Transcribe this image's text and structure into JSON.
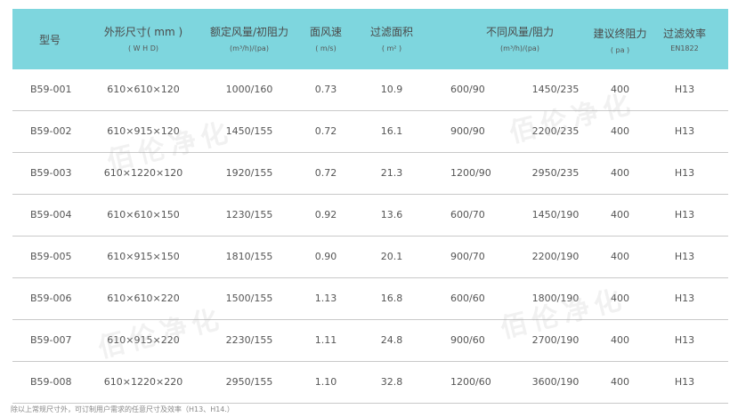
{
  "header": {
    "model": "型号",
    "size": "外形尺寸( mm )",
    "size_sub": "( W H D)",
    "airflow": "额定风量/初阻力",
    "airflow_sub": "(m³/h)/(pa)",
    "velocity": "面风速",
    "velocity_sub": "( m/s)",
    "area": "过滤面积",
    "area_sub": "( m² )",
    "diff": "不同风量/阻力",
    "diff_sub": "(m³/h)/(pa)",
    "final": "建议终阻力",
    "final_sub": "( pa )",
    "eff": "过滤效率",
    "eff_sub": "EN1822"
  },
  "rows": [
    {
      "model": "B59-001",
      "size": "610×610×120",
      "airflow": "1000/160",
      "velocity": "0.73",
      "area": "10.9",
      "d1": "600/90",
      "d2": "1450/235",
      "final": "400",
      "eff": "H13"
    },
    {
      "model": "B59-002",
      "size": "610×915×120",
      "airflow": "1450/155",
      "velocity": "0.72",
      "area": "16.1",
      "d1": "900/90",
      "d2": "2200/235",
      "final": "400",
      "eff": "H13"
    },
    {
      "model": "B59-003",
      "size": "610×1220×120",
      "airflow": "1920/155",
      "velocity": "0.72",
      "area": "21.3",
      "d1": "1200/90",
      "d2": "2950/235",
      "final": "400",
      "eff": "H13"
    },
    {
      "model": "B59-004",
      "size": "610×610×150",
      "airflow": "1230/155",
      "velocity": "0.92",
      "area": "13.6",
      "d1": "600/70",
      "d2": "1450/190",
      "final": "400",
      "eff": "H13"
    },
    {
      "model": "B59-005",
      "size": "610×915×150",
      "airflow": "1810/155",
      "velocity": "0.90",
      "area": "20.1",
      "d1": "900/70",
      "d2": "2200/190",
      "final": "400",
      "eff": "H13"
    },
    {
      "model": "B59-006",
      "size": "610×610×220",
      "airflow": "1500/155",
      "velocity": "1.13",
      "area": "16.8",
      "d1": "600/60",
      "d2": "1800/190",
      "final": "400",
      "eff": "H13"
    },
    {
      "model": "B59-007",
      "size": "610×915×220",
      "airflow": "2230/155",
      "velocity": "1.11",
      "area": "24.8",
      "d1": "900/60",
      "d2": "2700/190",
      "final": "400",
      "eff": "H13"
    },
    {
      "model": "B59-008",
      "size": "610×1220×220",
      "airflow": "2950/155",
      "velocity": "1.10",
      "area": "32.8",
      "d1": "1200/60",
      "d2": "3600/190",
      "final": "400",
      "eff": "H13"
    }
  ],
  "footnote": "除以上常规尺寸外，可订制用户需求的任意尺寸及效率（H13、H14.）",
  "watermark": "佰伦净化",
  "colors": {
    "header_bg": "#7ed6de",
    "row_border": "#c9c9c9"
  }
}
